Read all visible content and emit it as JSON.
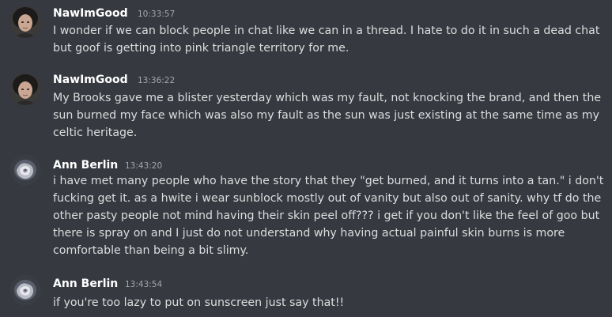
{
  "messages": [
    {
      "author": "NawImGood",
      "time": "10:33:57",
      "avatar_icon": "dark-hair-user-avatar",
      "lines": [
        "I wonder if we can block people in chat like we can in a thread. I hate to do it in such a dead chat",
        "but goof is getting into pink triangle territory for me."
      ]
    },
    {
      "author": "NawImGood",
      "time": "13:36:22",
      "avatar_icon": "dark-hair-user-avatar",
      "lines": [
        "My Brooks gave me a blister yesterday which was my fault, not knocking the brand, and then the",
        "sun burned my face which was also my fault as the sun was just existing at the same time as my",
        "celtic heritage."
      ]
    },
    {
      "author": "Ann Berlin",
      "time": "13:43:20",
      "avatar_icon": "flower-avatar",
      "lines": [
        "i have met many people who have the story that they \"get burned, and it turns into a tan.\" i don't",
        "fucking get it. as a hwite i wear sunblock mostly out of vanity but also out of sanity. why tf do the",
        "other pasty people not mind having their skin peel off??? i get if you don't like the feel of goo but",
        "there is spray on and I just do not understand why having actual painful skin burns is more",
        "comfortable than being a bit slimy."
      ]
    },
    {
      "author": "Ann Berlin",
      "time": "13:43:54",
      "avatar_icon": "flower-avatar",
      "lines": [
        "if you're too lazy to put on sunscreen just say that!!"
      ]
    }
  ]
}
